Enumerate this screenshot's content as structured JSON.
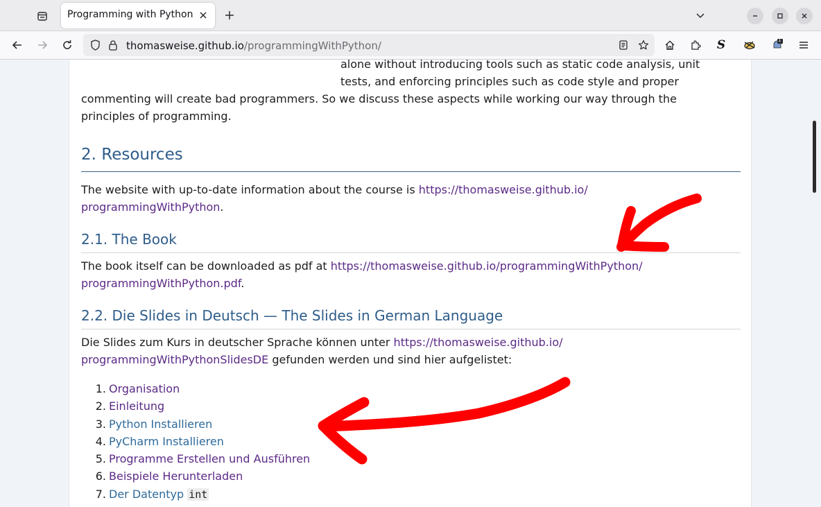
{
  "browser": {
    "tab_title": "Programming with Python",
    "url_host": "thomasweise.github.io",
    "url_path": "/programmingWithPython/"
  },
  "page": {
    "intro_line1": "alone without introducing tools such as static code analysis, unit",
    "intro_line2": "tests, and enforcing principles such as code style and proper",
    "intro_line3": "commenting will create bad programmers. So we discuss these aspects while working our way through the",
    "intro_line4": "principles of programming.",
    "resources_heading": "2. Resources",
    "resources_text": "The website with up-to-date information about the course is ",
    "resources_link_part1": "https://thomasweise.github.io/",
    "resources_link_part2": "programmingWithPython",
    "period": ".",
    "book_heading": "2.1. The Book",
    "book_text": "The book itself can be downloaded as pdf at ",
    "book_link_part1": "https://thomasweise.github.io/programmingWithPython/",
    "book_link_part2": "programmingWithPython.pdf",
    "slides_heading": "2.2. Die Slides in Deutsch — The Slides in German Language",
    "slides_text": "Die Slides zum Kurs in deutscher Sprache können unter ",
    "slides_link_part1": "https://thomasweise.github.io/",
    "slides_link_part2": "programmingWithPythonSlidesDE",
    "slides_text_after": " gefunden werden und sind hier aufgelistet:",
    "list": [
      {
        "num": "1.",
        "label": "Organisation"
      },
      {
        "num": "2.",
        "label": "Einleitung"
      },
      {
        "num": "3.",
        "label": "Python Installieren"
      },
      {
        "num": "4.",
        "label": "PyCharm Installieren"
      },
      {
        "num": "5.",
        "label": "Programme Erstellen und Ausführen"
      },
      {
        "num": "6.",
        "label": "Beispiele Herunterladen"
      },
      {
        "num": "7.",
        "label": "Der Datentyp ",
        "code": "int"
      }
    ]
  },
  "colors": {
    "link_visited": "#5b2a86",
    "link_unvisited": "#2e6a9c",
    "heading": "#2e5c8a",
    "annotation_arrow": "#ff0000"
  },
  "icons": {
    "notification_badge": "1"
  }
}
